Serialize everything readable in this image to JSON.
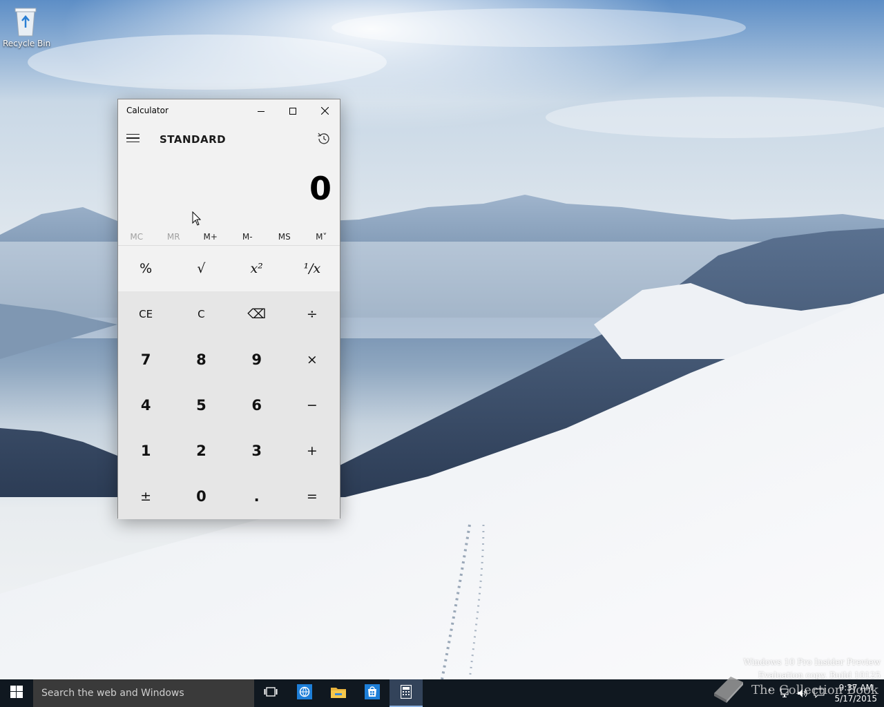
{
  "desktop": {
    "recycle_bin_label": "Recycle Bin",
    "watermark_line1": "Windows 10 Pro Insider Preview",
    "watermark_line2": "Evaluation copy. Build 10125"
  },
  "calculator": {
    "window_title": "Calculator",
    "mode": "STANDARD",
    "display_value": "0",
    "memory": [
      "MC",
      "MR",
      "M+",
      "M-",
      "MS",
      "M˅"
    ],
    "memory_disabled": [
      true,
      true,
      false,
      false,
      false,
      false
    ],
    "keys": [
      [
        "%",
        "√",
        "x²",
        "¹/x"
      ],
      [
        "CE",
        "C",
        "⌫",
        "÷"
      ],
      [
        "7",
        "8",
        "9",
        "×"
      ],
      [
        "4",
        "5",
        "6",
        "−"
      ],
      [
        "1",
        "2",
        "3",
        "+"
      ],
      [
        "±",
        "0",
        ".",
        "="
      ]
    ],
    "icons": {
      "menu": "hamburger-icon",
      "history": "history-icon",
      "minimize": "minimize-icon",
      "maximize": "maximize-icon",
      "close": "close-icon"
    }
  },
  "taskbar": {
    "search_placeholder": "Search the web and Windows",
    "time": "9:37 AM",
    "date": "5/17/2015",
    "brand_text": "The Collection Book",
    "apps": [
      "task-view-icon",
      "edge-icon",
      "file-explorer-icon",
      "store-icon",
      "calculator-icon"
    ]
  }
}
